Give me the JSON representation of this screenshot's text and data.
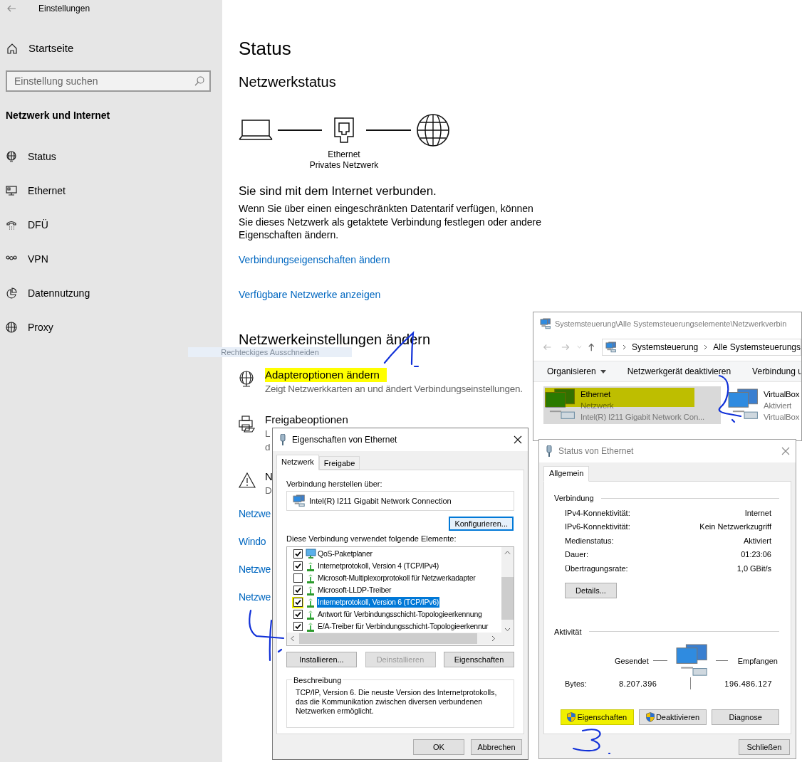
{
  "settings_window": {
    "title": "Einstellungen",
    "home": "Startseite",
    "search": {
      "placeholder": "Einstellung suchen"
    },
    "section": "Netzwerk und Internet",
    "nav": [
      {
        "kind": "status",
        "label": "Status"
      },
      {
        "kind": "ethernet",
        "label": "Ethernet"
      },
      {
        "kind": "dialup",
        "label": "DFÜ"
      },
      {
        "kind": "vpn",
        "label": "VPN"
      },
      {
        "kind": "data_usage",
        "label": "Datennutzung"
      },
      {
        "kind": "proxy",
        "label": "Proxy"
      }
    ]
  },
  "status_page": {
    "title": "Status",
    "subtitle": "Netzwerkstatus",
    "diagram": {
      "adapter": "Ethernet",
      "network": "Privates Netzwerk"
    },
    "connection_heading": "Sie sind mit dem Internet verbunden.",
    "connection_text": "Wenn Sie über einen eingeschränkten Datentarif verfügen, können Sie dieses Netzwerk als getaktete Verbindung festlegen oder andere Eigenschaften ändern.",
    "links": [
      "Verbindungseigenschaften ändern",
      "Verfügbare Netzwerke anzeigen"
    ],
    "settings_heading": "Netzwerkeinstellungen ändern",
    "options": [
      {
        "kind": "adapter",
        "title": "Adapteroptionen ändern",
        "highlighted": true,
        "description": [
          "Zeigt Netzwerkkarten an und ändert Verbindungseinstellungen."
        ]
      },
      {
        "kind": "sharing",
        "title": "Freigabeoptionen",
        "highlighted": false,
        "description": [
          "L",
          "d"
        ]
      },
      {
        "kind": "troubleshoot",
        "title": "N",
        "highlighted": false,
        "description": [
          "D"
        ]
      }
    ],
    "more_links": [
      "Netzwe",
      "Windo",
      "Netzwe",
      "Netzwe"
    ]
  },
  "snip_tooltip": "Rechteckiges Ausschneiden",
  "connections_window": {
    "title": "Systemsteuerung\\Alle Systemsteuerungselemente\\Netzwerkverbin",
    "breadcrumb": [
      "Systemsteuerung",
      "Alle Systemsteuerungs"
    ],
    "organize_menu": "Organisieren",
    "toolbar": [
      "Netzwerkgerät deaktivieren",
      "Verbindung u"
    ],
    "adapters": [
      {
        "name": "Ethernet",
        "status": "Netzwerk",
        "device": "Intel(R) I211 Gigabit Network Con...",
        "selected": true,
        "highlighted": true
      },
      {
        "name": "VirtualBox",
        "status": "Aktiviert",
        "device": "VirtualBox",
        "selected": false,
        "highlighted": false
      }
    ]
  },
  "properties_dialog": {
    "title": "Eigenschaften von Ethernet",
    "tabs": [
      {
        "label": "Netzwerk",
        "selected": true
      },
      {
        "label": "Freigabe",
        "selected": false
      }
    ],
    "connect_label": "Verbindung herstellen über:",
    "adapter": "Intel(R) I211 Gigabit Network Connection",
    "configure": "Konfigurieren...",
    "items_label": "Diese Verbindung verwendet folgende Elemente:",
    "items": [
      {
        "kind": "service",
        "label": "QoS-Paketplaner",
        "checked": true,
        "selected": false,
        "highlighted": false
      },
      {
        "kind": "protocol",
        "label": "Internetprotokoll, Version 4 (TCP/IPv4)",
        "checked": true,
        "selected": false,
        "highlighted": false
      },
      {
        "kind": "protocol",
        "label": "Microsoft-Multiplexorprotokoll für Netzwerkadapter",
        "checked": false,
        "selected": false,
        "highlighted": false
      },
      {
        "kind": "protocol",
        "label": "Microsoft-LLDP-Treiber",
        "checked": true,
        "selected": false,
        "highlighted": false
      },
      {
        "kind": "protocol",
        "label": "Internetprotokoll, Version 6 (TCP/IPv6)",
        "checked": true,
        "selected": true,
        "highlighted": true
      },
      {
        "kind": "protocol",
        "label": "Antwort für Verbindungsschicht-Topologieerkennung",
        "checked": true,
        "selected": false,
        "highlighted": false
      },
      {
        "kind": "protocol",
        "label": "E/A-Treiber für Verbindungsschicht-Topologieerkennur",
        "checked": true,
        "selected": false,
        "highlighted": false
      }
    ],
    "buttons": [
      {
        "label": "Installieren...",
        "disabled": false
      },
      {
        "label": "Deinstallieren",
        "disabled": true
      },
      {
        "label": "Eigenschaften",
        "disabled": false
      }
    ],
    "description_label": "Beschreibung",
    "description": "TCP/IP, Version 6. Die neuste Version des Internetprotokolls, das die Kommunikation zwischen diversen verbundenen Netzwerken ermöglicht.",
    "footer": [
      "OK",
      "Abbrechen"
    ]
  },
  "status_dialog": {
    "title": "Status von Ethernet",
    "tab": "Allgemein",
    "connection_label": "Verbindung",
    "rows": [
      {
        "label": "IPv4-Konnektivität:",
        "value": "Internet"
      },
      {
        "label": "IPv6-Konnektivität:",
        "value": "Kein Netzwerkzugriff"
      },
      {
        "label": "Medienstatus:",
        "value": "Aktiviert"
      },
      {
        "label": "Dauer:",
        "value": "01:23:06"
      },
      {
        "label": "Übertragungsrate:",
        "value": "1,0 GBit/s"
      }
    ],
    "details": "Details...",
    "activity_label": "Aktivität",
    "sent": "Gesendet",
    "received": "Empfangen",
    "bytes_label": "Bytes:",
    "bytes_sent": "8.207.396",
    "bytes_received": "196.486.127",
    "buttons": [
      {
        "label": "Eigenschaften",
        "shield": true,
        "highlighted": true
      },
      {
        "label": "Deaktivieren",
        "shield": true,
        "highlighted": false
      },
      {
        "label": "Diagnose",
        "shield": false,
        "highlighted": false
      }
    ],
    "close": "Schließen"
  }
}
